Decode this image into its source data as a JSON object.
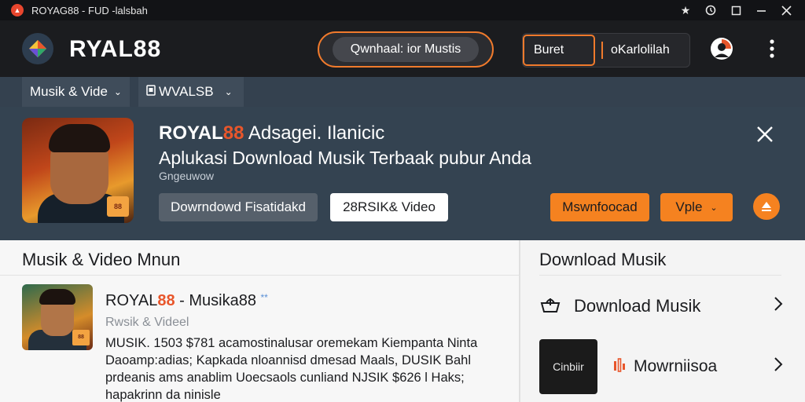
{
  "window": {
    "title": "ROYAG88 - FUD -lalsbah",
    "controls": [
      "star-icon",
      "history-icon",
      "maximize-icon",
      "minimize-icon",
      "close-icon"
    ]
  },
  "header": {
    "logo_text": "RYAL88",
    "download_pill": "Qwnhaal: ior Mustis",
    "search_left": "Buret",
    "search_right": "oKarlolilah",
    "accent_color": "#f07a2c"
  },
  "subnav": {
    "item1": "Musik & Vide",
    "item2": "WVALSB"
  },
  "banner": {
    "title_brand": "ROYAL",
    "title_num": "88",
    "title_rest": " Adsagei. Ilanicic",
    "subtitle": "Aplukasi Download Musik Terbaak pubur Anda",
    "small": "Gngeuwow",
    "thumb_badge": "88",
    "btn_download": "Dowrndowd Fisatidakd",
    "btn_video": "28RSIK& Video",
    "btn_orange1": "Mswnfoocad",
    "btn_orange2": "Vple"
  },
  "left_pane": {
    "heading": "Musik & Video Mnun",
    "item": {
      "title_brand": "ROYAL",
      "title_num": "88",
      "title_rest": " - Musika88",
      "star": "**",
      "category": "Rwsik & Videel",
      "badge": "88",
      "desc_lines": [
        "MUSIK. 1503 $781  acamostinalusar oremekam Kiempanta Ninta",
        "Daoamp:adias; Kapkada nloannisd dmesad Maals, DUSIK Bahl",
        "prdeanis ams anablim Uoecsaols cunliand NJSIK $626 l Haks;",
        "hapakrinn da ninisle"
      ]
    }
  },
  "right_pane": {
    "heading": "Download Musik",
    "row1_label": "Download Musik",
    "row2_tile": "Cinbiir",
    "row2_label": "Mowrniisoa"
  }
}
